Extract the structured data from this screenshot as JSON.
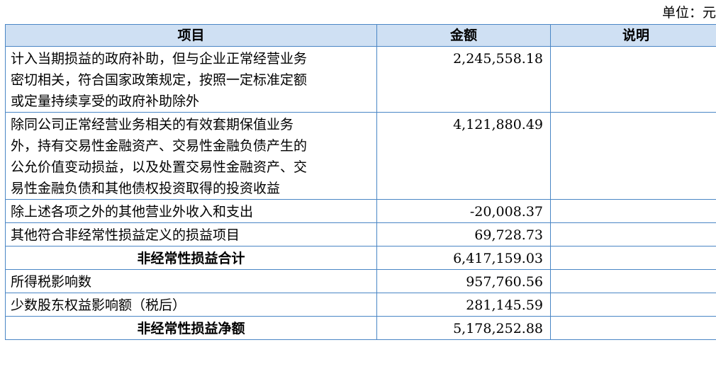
{
  "unit_label": "单位：元",
  "headers": {
    "item": "项目",
    "amount": "金额",
    "note": "说明"
  },
  "rows": [
    {
      "item_lines": [
        "计入当期损益的政府补助，但与企业正常经营业务",
        "密切相关，符合国家政策规定，按照一定标准定额",
        "或定量持续享受的政府补助除外"
      ],
      "amount": "2,245,558.18",
      "note": ""
    },
    {
      "item_lines": [
        "除同公司正常经营业务相关的有效套期保值业务",
        "外，持有交易性金融资产、交易性金融负债产生的",
        "公允价值变动损益，以及处置交易性金融资产、交",
        "易性金融负债和其他债权投资取得的投资收益"
      ],
      "amount": "4,121,880.49",
      "note": ""
    },
    {
      "item": "除上述各项之外的其他营业外收入和支出",
      "amount": "-20,008.37",
      "note": ""
    },
    {
      "item": "其他符合非经常性损益定义的损益项目",
      "amount": "69,728.73",
      "note": ""
    },
    {
      "item": "非经常性损益合计",
      "amount": "6,417,159.03",
      "note": ""
    },
    {
      "item": "所得税影响数",
      "amount": "957,760.56",
      "note": ""
    },
    {
      "item": "少数股东权益影响额（税后）",
      "amount": "281,145.59",
      "note": ""
    },
    {
      "item": "非经常性损益净额",
      "amount": "5,178,252.88",
      "note": ""
    }
  ]
}
